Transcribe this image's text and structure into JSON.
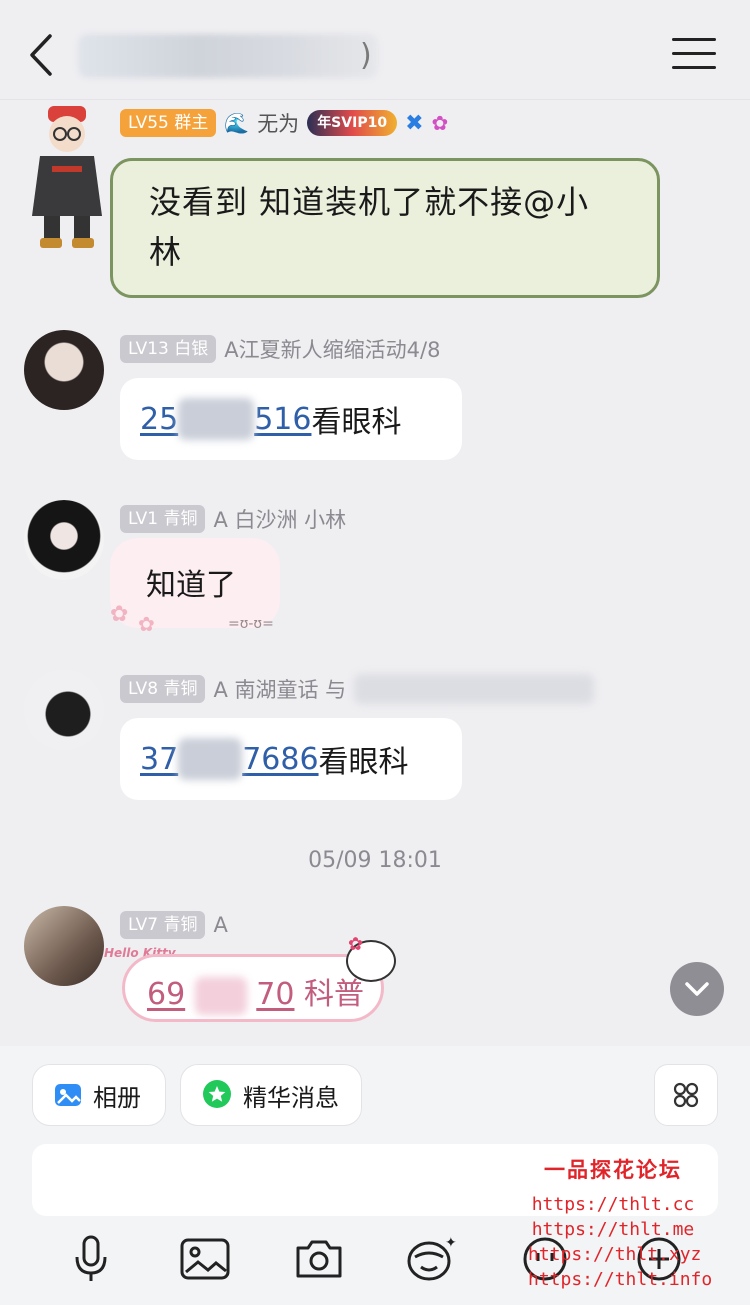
{
  "header": {
    "title_suffix": ")"
  },
  "messages": [
    {
      "level": "LV55",
      "role": "群主",
      "nickname": "无为",
      "vip_badge": "年SVIP10",
      "text": "没看到 知道装机了就不接@小林"
    },
    {
      "level": "LV13",
      "role": "白银",
      "nickname": "A江夏新人缩缩活动4/8",
      "number_prefix": "25",
      "number_suffix": "516",
      "text_suffix": "看眼科"
    },
    {
      "level": "LV1",
      "role": "青铜",
      "nickname": "A 白沙洲 小林",
      "text": "知道了",
      "sticker_face": "=ʊ-ʊ="
    },
    {
      "level": "LV8",
      "role": "青铜",
      "nickname": "A 南湖童话 与",
      "number_prefix": "37",
      "number_suffix": "7686",
      "text_suffix": "看眼科"
    },
    {
      "level": "LV7",
      "role": "青铜",
      "nickname": "A",
      "sticker_label": "Hello Kitty",
      "number_prefix": "69",
      "number_suffix": "70",
      "text_suffix": "科普"
    }
  ],
  "timestamp": "05/09 18:01",
  "panel": {
    "album_label": "相册",
    "essence_label": "精华消息"
  },
  "toolbar": {
    "icons": [
      "microphone-icon",
      "image-icon",
      "camera-icon",
      "emoji-icon",
      "sticker-icon",
      "plus-icon"
    ]
  },
  "watermark": {
    "title": "一品探花论坛",
    "urls": [
      "https://thlt.cc",
      "https://thlt.me",
      "https://thlt.xyz",
      "https://thlt.info"
    ]
  },
  "colors": {
    "background": "#efeff2",
    "link": "#2f5fa8",
    "owner_badge": "#f5a23a",
    "level_badge": "#c9c9cf",
    "watermark": "#e0252a"
  }
}
